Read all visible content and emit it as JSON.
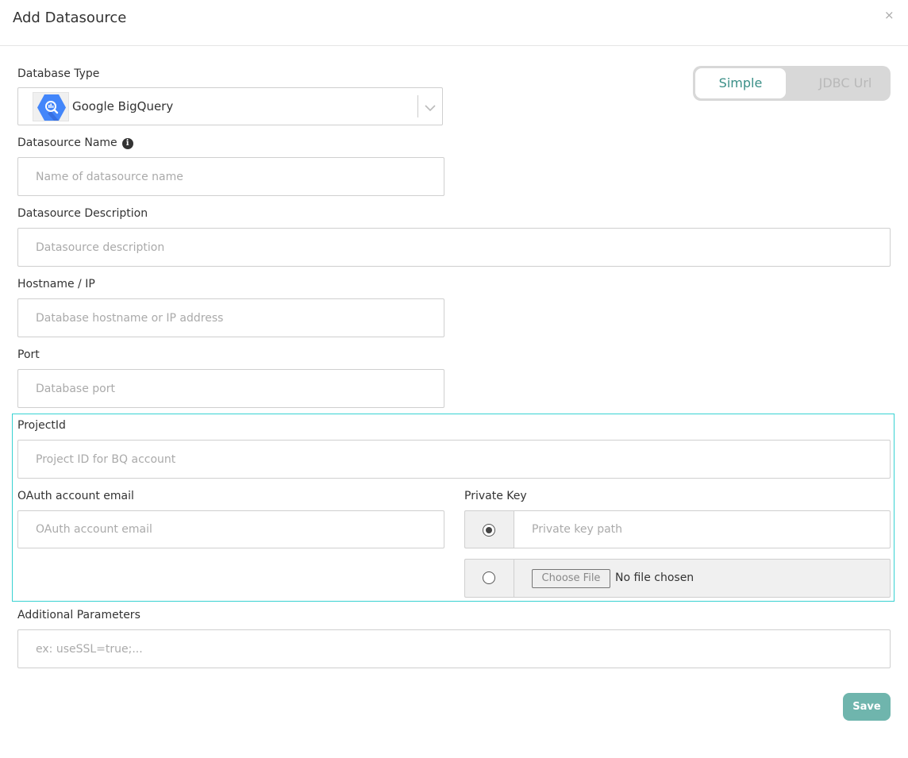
{
  "dialog": {
    "title": "Add Datasource",
    "close_label": "×"
  },
  "mode_toggle": {
    "simple_label": "Simple",
    "jdbc_label": "JDBC Url",
    "active": "Simple"
  },
  "database_type": {
    "label": "Database Type",
    "selected": "Google BigQuery",
    "icon": "bigquery-icon"
  },
  "datasource_name": {
    "label": "Datasource Name",
    "placeholder": "Name of datasource name"
  },
  "datasource_description": {
    "label": "Datasource Description",
    "placeholder": "Datasource description"
  },
  "hostname": {
    "label": "Hostname / IP",
    "placeholder": "Database hostname or IP address"
  },
  "port": {
    "label": "Port",
    "placeholder": "Database port"
  },
  "project_id": {
    "label": "ProjectId",
    "placeholder": "Project ID for BQ account"
  },
  "oauth_email": {
    "label": "OAuth account email",
    "placeholder": "OAuth account email"
  },
  "private_key": {
    "label": "Private Key",
    "path_placeholder": "Private key path",
    "choose_file_label": "Choose File",
    "file_status": "No file chosen",
    "selected_option": "path"
  },
  "additional_parameters": {
    "label": "Additional Parameters",
    "placeholder": "ex: useSSL=true;..."
  },
  "actions": {
    "save_label": "Save"
  },
  "colors": {
    "accent": "#3a8f87",
    "save_button": "#6fb5ad",
    "highlight_border": "#38d2d2",
    "bigquery_blue": "#4386fa"
  }
}
